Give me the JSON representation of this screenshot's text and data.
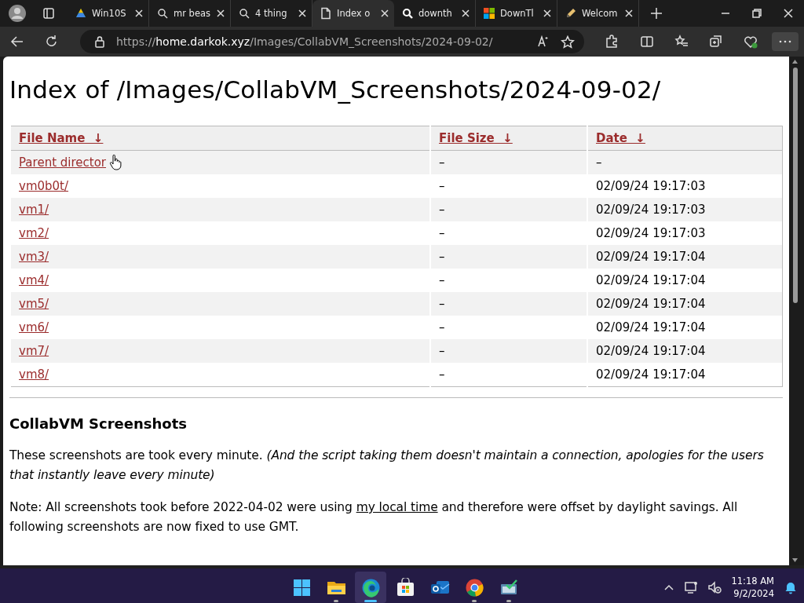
{
  "tabs": [
    {
      "kind": "drive",
      "title": "Win10S",
      "selected": false
    },
    {
      "kind": "search",
      "title": "mr beas",
      "selected": false
    },
    {
      "kind": "search",
      "title": "4 thing",
      "selected": false
    },
    {
      "kind": "page",
      "title": "Index o",
      "selected": true
    },
    {
      "kind": "search-bold",
      "title": "downth",
      "selected": false
    },
    {
      "kind": "windows",
      "title": "DownTl",
      "selected": false
    },
    {
      "kind": "pencil",
      "title": "Welcom",
      "selected": false
    }
  ],
  "address_bar": {
    "scheme": "https://",
    "host": "home.darkok.xyz",
    "path": "/Images/CollabVM_Screenshots/2024-09-02/"
  },
  "page": {
    "heading": "Index of /Images/CollabVM_Screenshots/2024-09-02/",
    "table": {
      "columns": [
        {
          "label": "File Name",
          "arrow": "↓"
        },
        {
          "label": "File Size",
          "arrow": "↓"
        },
        {
          "label": "Date",
          "arrow": "↓"
        }
      ],
      "rows": [
        {
          "name": "Parent director",
          "size": "–",
          "date": "–"
        },
        {
          "name": "vm0b0t/",
          "size": "–",
          "date": "02/09/24 19:17:03"
        },
        {
          "name": "vm1/",
          "size": "–",
          "date": "02/09/24 19:17:03"
        },
        {
          "name": "vm2/",
          "size": "–",
          "date": "02/09/24 19:17:03"
        },
        {
          "name": "vm3/",
          "size": "–",
          "date": "02/09/24 19:17:04"
        },
        {
          "name": "vm4/",
          "size": "–",
          "date": "02/09/24 19:17:04"
        },
        {
          "name": "vm5/",
          "size": "–",
          "date": "02/09/24 19:17:04"
        },
        {
          "name": "vm6/",
          "size": "–",
          "date": "02/09/24 19:17:04"
        },
        {
          "name": "vm7/",
          "size": "–",
          "date": "02/09/24 19:17:04"
        },
        {
          "name": "vm8/",
          "size": "–",
          "date": "02/09/24 19:17:04"
        }
      ]
    },
    "section_title": "CollabVM Screenshots",
    "paragraph_1": "These screenshots are took every minute. *(And the script taking them doesn't maintain a connection, apologies for the users that instantly leave every minute)*",
    "paragraph_2": {
      "before": "Note: All screenshots took before 2022-04-02 were using ",
      "link": "my local time",
      "after": " and therefore were offset by daylight savings. All following screenshots are now fixed to use GMT."
    }
  },
  "taskbar": {
    "apps": [
      {
        "kind": "start",
        "running": false,
        "active": false
      },
      {
        "kind": "folder",
        "running": true,
        "active": false
      },
      {
        "kind": "edge",
        "running": true,
        "active": true
      },
      {
        "kind": "store",
        "running": false,
        "active": false
      },
      {
        "kind": "outlook",
        "running": false,
        "active": false
      },
      {
        "kind": "chrome",
        "running": true,
        "active": false
      },
      {
        "kind": "tool",
        "running": true,
        "active": false
      }
    ],
    "time": "11:18 AM",
    "date": "9/2/2024"
  }
}
